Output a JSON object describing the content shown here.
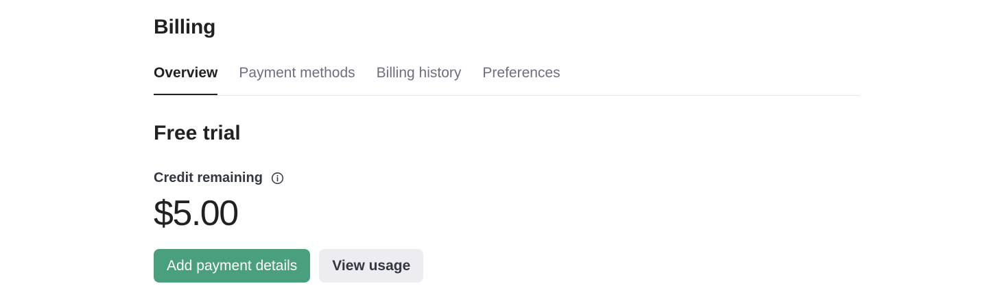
{
  "page": {
    "title": "Billing"
  },
  "tabs": [
    {
      "label": "Overview",
      "active": true
    },
    {
      "label": "Payment methods",
      "active": false
    },
    {
      "label": "Billing history",
      "active": false
    },
    {
      "label": "Preferences",
      "active": false
    }
  ],
  "plan": {
    "title": "Free trial",
    "credit_label": "Credit remaining",
    "credit_icon": "info-icon",
    "credit_amount": "$5.00"
  },
  "actions": {
    "add_payment_label": "Add payment details",
    "view_usage_label": "View usage"
  },
  "colors": {
    "primary_button": "#4aa07c",
    "secondary_button": "#ececf1",
    "text_primary": "#202123",
    "text_muted": "#6e6e80",
    "divider": "#e5e5e5"
  }
}
